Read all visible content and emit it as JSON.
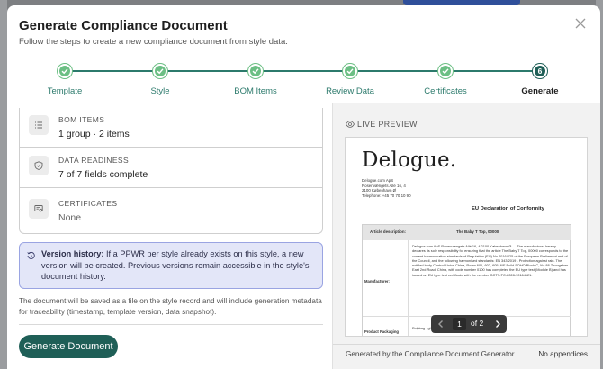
{
  "modal": {
    "title": "Generate Compliance Document",
    "subtitle": "Follow the steps to create a new compliance document from style data."
  },
  "stepper": {
    "steps": [
      {
        "label": "Template",
        "state": "complete"
      },
      {
        "label": "Style",
        "state": "complete"
      },
      {
        "label": "BOM Items",
        "state": "complete"
      },
      {
        "label": "Review Data",
        "state": "complete"
      },
      {
        "label": "Certificates",
        "state": "complete"
      },
      {
        "label": "Generate",
        "state": "active",
        "number": "6"
      }
    ],
    "colors": {
      "complete": "#6cbf84",
      "active": "#1f5f57",
      "line": "#2c7a6c"
    }
  },
  "summary": {
    "bom_label": "BOM ITEMS",
    "bom_value": "1 group · 2 items",
    "readiness_label": "DATA READINESS",
    "readiness_value": "7 of 7 fields complete",
    "certs_label": "CERTIFICATES",
    "certs_value": "None",
    "icons": {
      "bom": "list-icon",
      "readiness": "shield-check-icon",
      "certs": "certificate-icon"
    }
  },
  "notice": {
    "title": "Version history:",
    "text": " If a PPWR per style already exists on this style, a new version will be created. Previous versions remain accessible in the style's document history."
  },
  "footnote": "The document will be saved as a file on the style record and will include generation metadata for traceability (timestamp, template version, data snapshot).",
  "actions": {
    "generate_label": "Generate Document",
    "accent": "#1f5f57"
  },
  "preview": {
    "label": "LIVE PREVIEW",
    "doc": {
      "logo": "Delogue.",
      "address": [
        "Delogue.com ApS",
        "Rosenvængets Allé 16, 4",
        "2100 København Ø",
        "Telephone: +45 70 70 10 90"
      ],
      "title": "EU Declaration of Conformity",
      "table_header_label": "Article description:",
      "table_header_value": "The Baby T Top, 00000",
      "manufacturer_label": "Manufacturer:",
      "manufacturer_text": "Delogue.com ApS Rosenvængets Allé 16, 4 2100 København Ø — The manufacturer hereby declares its sole responsibility for ensuring that the article The Baby T Top, 00000 corresponds to the current harmonisation standards of Regulation (EU) No 2016/425 of the European Parliament and of the Council, and the following harmonised standards: EN 343:2019 - Protection against rain. The notified body Control Union China, Room 601, 602, 605, 6/F Build SOHO Block C, No.88 Zhongshan East 2nd Road, China, with code number 0100 has completed the EU type test (Module B) and has issued an EU type test certificate with the number GCTS-TC-2028-10164121.",
      "packaging_label": "Product Packaging",
      "packaging_value": "Polybag - gl"
    },
    "pager": {
      "current": "1",
      "of_label": "of",
      "total": "2"
    },
    "footer_left": "Generated by the Compliance Document Generator",
    "footer_right": "No appendices"
  }
}
